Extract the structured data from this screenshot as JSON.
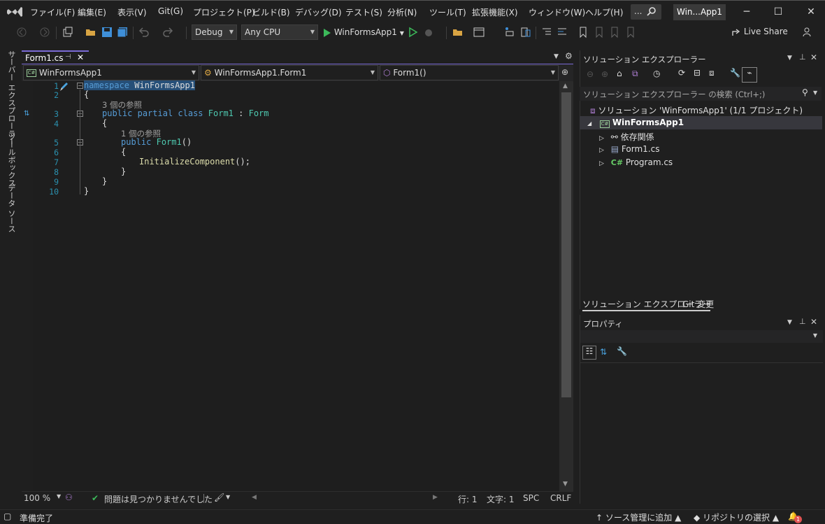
{
  "menu": {
    "items": [
      "ファイル(F)",
      "編集(E)",
      "表示(V)",
      "Git(G)",
      "プロジェクト(P)",
      "ビルド(B)",
      "デバッグ(D)",
      "テスト(S)",
      "分析(N)",
      "ツール(T)",
      "拡張機能(X)",
      "ウィンドウ(W)",
      "ヘルプ(H)"
    ],
    "search_label": "...",
    "project_badge": "Win...App1"
  },
  "toolbar": {
    "config": "Debug",
    "platform": "Any CPU",
    "run_label": "WinFormsApp1",
    "live_share": "Live Share"
  },
  "left_tabs": [
    "サーバー エクスプローラー",
    "ツールボックス",
    "データ ソース"
  ],
  "editor": {
    "tab_title": "Form1.cs",
    "nav_project": "WinFormsApp1",
    "nav_class": "WinFormsApp1.Form1",
    "nav_member": "Form1()",
    "line_numbers": [
      "1",
      "2",
      "3",
      "4",
      "5",
      "6",
      "7",
      "8",
      "9",
      "10"
    ],
    "code": {
      "ns_kw": "namespace",
      "ns_name": "WinFormsApp1",
      "brace_open": "{",
      "ref3": "3 個の参照",
      "l3_public": "public",
      "l3_partial": "partial",
      "l3_class": "class",
      "l3_name": "Form1",
      "l3_colon": ":",
      "l3_base": "Form",
      "ref1": "1 個の参照",
      "l5_public": "public",
      "l5_name": "Form1",
      "l5_parens": "()",
      "l7_call": "InitializeComponent",
      "l7_rest": "();",
      "brace_close": "}"
    },
    "zoom": "100 %",
    "issues": "問題は見つかりませんでした",
    "line_label": "行: 1",
    "col_label": "文字: 1",
    "spc": "SPC",
    "crlf": "CRLF"
  },
  "solution_explorer": {
    "title": "ソリューション エクスプローラー",
    "search_placeholder": "ソリューション エクスプローラー の検索 (Ctrl+;)",
    "solution": "ソリューション 'WinFormsApp1' (1/1 プロジェクト)",
    "project": "WinFormsApp1",
    "items": [
      "依存関係",
      "Form1.cs",
      "Program.cs"
    ],
    "tab_se": "ソリューション エクスプローラー",
    "tab_git": "Git 変更"
  },
  "properties": {
    "title": "プロパティ"
  },
  "status": {
    "ready": "準備完了",
    "source_control": "ソース管理に追加",
    "repo": "リポジトリの選択",
    "notifications": "1"
  },
  "colors": {
    "accent": "#7a6ad6",
    "keyword": "#569cd6",
    "type": "#4ec9b0",
    "line_number": "#2b91af"
  }
}
